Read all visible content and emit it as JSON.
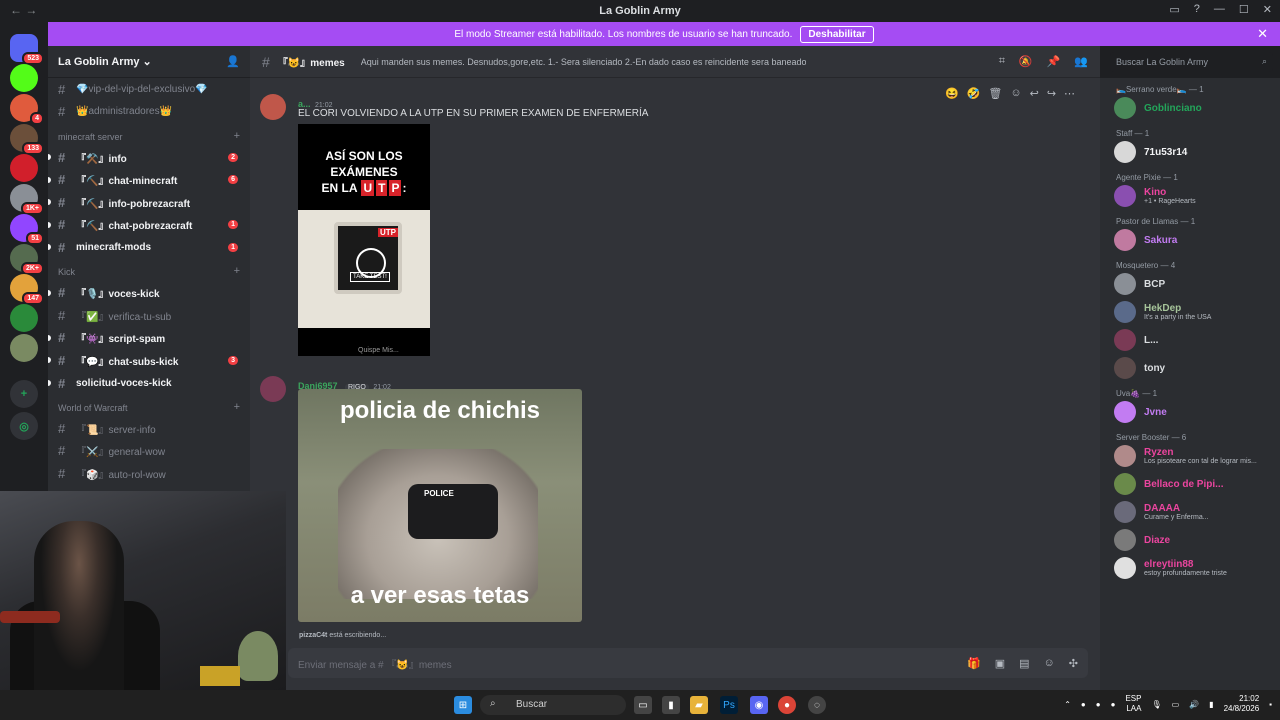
{
  "window": {
    "title": "La Goblin Army"
  },
  "banner": {
    "text": "El modo Streamer está habilitado. Los nombres de usuario se han truncado.",
    "button": "Deshabilitar"
  },
  "servers": [
    {
      "badge": "523",
      "color": "#5865f2"
    },
    {
      "badge": "",
      "color": "#53fc18"
    },
    {
      "badge": "4",
      "color": "#e05b3d"
    },
    {
      "badge": "133",
      "color": "#6b4f3a"
    },
    {
      "badge": "",
      "color": "#d11f2b"
    },
    {
      "badge": "1K+",
      "color": "#8a8f96"
    },
    {
      "badge": "51",
      "color": "#9146ff"
    },
    {
      "badge": "2K+",
      "color": "#556b4f"
    },
    {
      "badge": "147",
      "color": "#e3a23b"
    },
    {
      "badge": "",
      "color": "#2a8a3a"
    },
    {
      "badge": "",
      "color": "#7a8a62"
    }
  ],
  "guild": {
    "name": "La Goblin Army"
  },
  "channels": {
    "top": [
      {
        "label": "💎vip-del-vip-del-exclusivo💎",
        "unread": false,
        "count": ""
      },
      {
        "label": "👑administradores👑",
        "unread": false,
        "count": ""
      }
    ],
    "cat1": "minecraft server",
    "list1": [
      {
        "label": "『⚒️』info",
        "unread": true,
        "count": "2"
      },
      {
        "label": "『⛏️』chat-minecraft",
        "unread": true,
        "count": "6"
      },
      {
        "label": "『⛏️』info-pobrezacraft",
        "unread": true,
        "count": ""
      },
      {
        "label": "『⛏️』chat-pobrezacraft",
        "unread": true,
        "count": "1"
      },
      {
        "label": "minecraft-mods",
        "unread": true,
        "count": "1"
      }
    ],
    "cat2": "Kick",
    "list2": [
      {
        "label": "『🎙️』voces-kick",
        "unread": true,
        "count": ""
      },
      {
        "label": "『✅』verifica-tu-sub",
        "unread": false,
        "count": ""
      },
      {
        "label": "『👾』script-spam",
        "unread": true,
        "count": ""
      },
      {
        "label": "『💬』chat-subs-kick",
        "unread": true,
        "count": "3"
      },
      {
        "label": "solicitud-voces-kick",
        "unread": true,
        "count": ""
      }
    ],
    "cat3": "World of Warcraft",
    "list3": [
      {
        "label": "『📜』server-info",
        "unread": false,
        "count": ""
      },
      {
        "label": "『⚔️』general-wow",
        "unread": false,
        "count": ""
      },
      {
        "label": "『🎲』auto-rol-wow",
        "unread": false,
        "count": ""
      }
    ]
  },
  "chat": {
    "channel": "『😺』memes",
    "topic": "Aqui manden sus memes. Desnudos,gore,etc. 1.- Sera silenciado 2.-En dado caso es reincidente sera baneado",
    "search_placeholder": "Buscar La Goblin Army",
    "msg1": {
      "author": "a...",
      "time": "21:02",
      "text": "EL CORI VOLVIENDO A LA UTP EN SU PRIMER EXAMEN DE ENFERMERÍA",
      "meme_line1": "ASÍ SON LOS",
      "meme_line2": "EXÁMENES",
      "meme_line3": "EN LA",
      "meme_utp": [
        "U",
        "T",
        "P"
      ],
      "meme_colon": ":",
      "screen_utp": "UTP",
      "take_test": "TAKE TEST!",
      "watermark": "Quispe Mis..."
    },
    "msg2": {
      "author": "Dani6957",
      "tag": "RIGO",
      "time": "21:02",
      "meme_top": "policia de chichis",
      "meme_bottom": "a ver esas tetas",
      "vest_text": "POLICE"
    },
    "typing": {
      "user": "pizzaC4t",
      "text": " está escribiendo..."
    },
    "composer_placeholder": "Enviar mensaje a # 『😺』memes"
  },
  "members": {
    "groups": [
      {
        "title": "🛌Serrano verde🛌 — 1",
        "members": [
          {
            "name": "Goblinciano",
            "status": "",
            "color": "#23a55a"
          }
        ]
      },
      {
        "title": "Staff — 1",
        "members": [
          {
            "name": "71u53r14",
            "status": "",
            "color": "#f2f3f5"
          }
        ]
      },
      {
        "title": "Agente Pixie — 1",
        "members": [
          {
            "name": "Kino",
            "status": "+1 • RageHearts",
            "color": "#eb459f"
          }
        ]
      },
      {
        "title": "Pastor de Llamas — 1",
        "members": [
          {
            "name": "Sakura",
            "status": "",
            "color": "#c27cf2"
          }
        ]
      },
      {
        "title": "Mosquetero — 4",
        "members": [
          {
            "name": "BCP",
            "status": "",
            "color": "#dbdee1"
          },
          {
            "name": "HekDep",
            "status": "It's a party in the USA",
            "color": "#a6c49a"
          },
          {
            "name": "L...",
            "status": "",
            "color": "#dbdee1"
          },
          {
            "name": "tony",
            "status": "",
            "color": "#dbdee1"
          }
        ]
      },
      {
        "title": "Uva🍇 — 1",
        "members": [
          {
            "name": "Jvne",
            "status": "",
            "color": "#c27cf2"
          }
        ]
      },
      {
        "title": "Server Booster — 6",
        "members": [
          {
            "name": "Ryzen",
            "status": "Los pisoteare con tal de lograr mis...",
            "color": "#eb459f"
          },
          {
            "name": "Bellaco de Pipi...",
            "status": "",
            "color": "#eb459f"
          },
          {
            "name": "DAAAA",
            "status": "Curame y Enferma...",
            "color": "#eb459f"
          },
          {
            "name": "Diaze",
            "status": "",
            "color": "#eb459f"
          },
          {
            "name": "elreytiin88",
            "status": "estoy profundamente triste",
            "color": "#eb459f"
          }
        ]
      }
    ]
  },
  "taskbar": {
    "search": "Buscar",
    "lang1": "ESP",
    "lang2": "LAA",
    "time": "21:02",
    "date": "24/8/2026"
  }
}
